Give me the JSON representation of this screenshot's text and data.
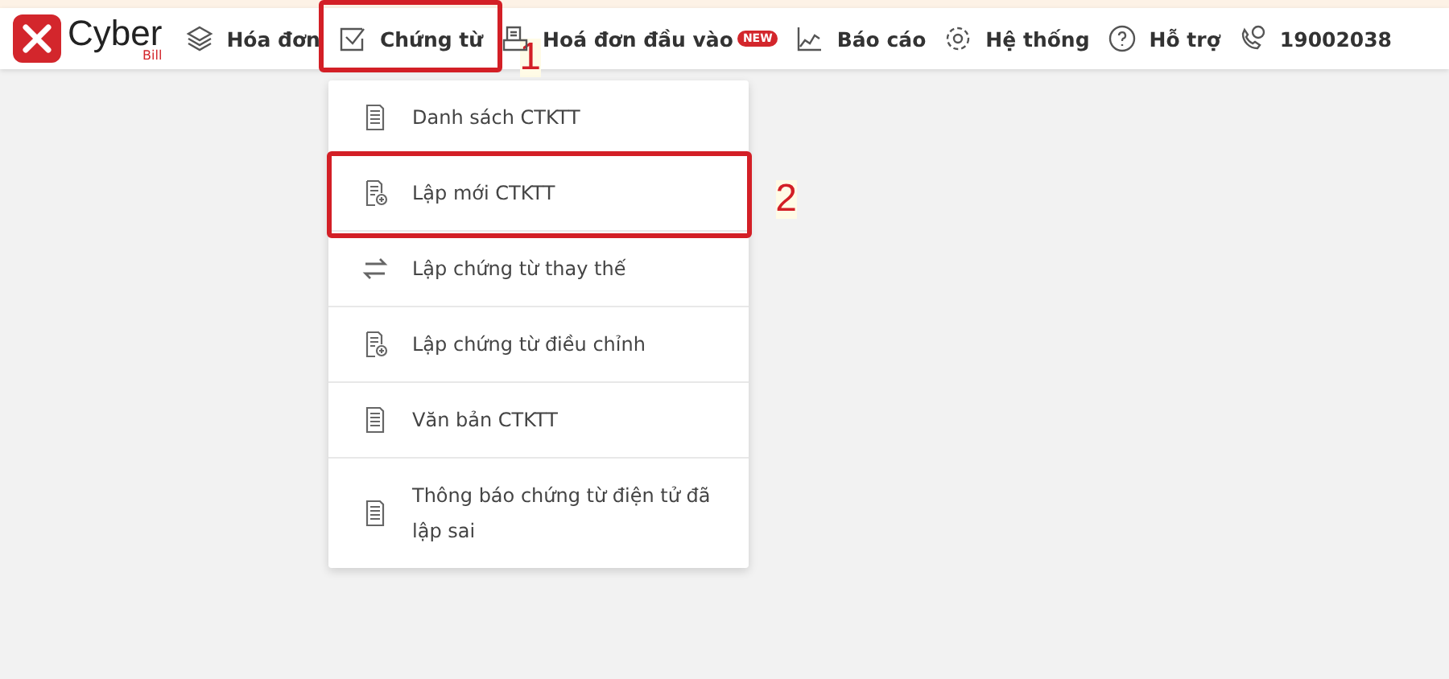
{
  "logo": {
    "name": "Cyber",
    "sub": "Bill"
  },
  "nav": [
    {
      "kind": "layers",
      "label": "Hóa đơn"
    },
    {
      "kind": "check",
      "label": "Chứng từ",
      "callout": "1"
    },
    {
      "kind": "inbox",
      "label": "Hoá đơn đầu vào",
      "badge": "NEW"
    },
    {
      "kind": "chart",
      "label": "Báo cáo"
    },
    {
      "kind": "gear",
      "label": "Hệ thống"
    },
    {
      "kind": "help",
      "label": "Hỗ trợ"
    },
    {
      "kind": "phone",
      "label": "19002038"
    }
  ],
  "menu": [
    {
      "kind": "doc",
      "label": "Danh sách CTKTT"
    },
    {
      "kind": "newdoc",
      "label": "Lập mới CTKTT",
      "callout": "2"
    },
    {
      "kind": "swap",
      "label": "Lập chứng từ thay thế"
    },
    {
      "kind": "newdoc",
      "label": "Lập chứng từ điều chỉnh"
    },
    {
      "kind": "doc",
      "label": "Văn bản CTKTT"
    },
    {
      "kind": "doc",
      "label": "Thông báo chứng từ điện tử đã lập sai"
    }
  ]
}
